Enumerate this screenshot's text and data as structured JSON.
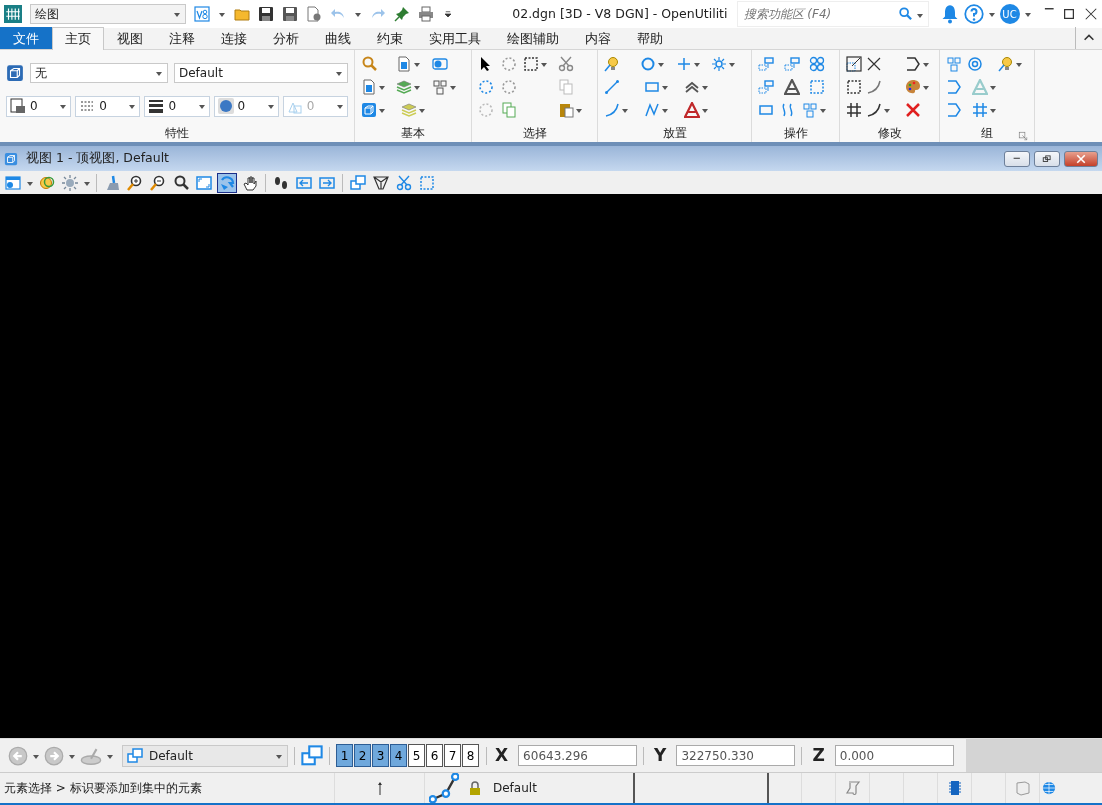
{
  "workflow": {
    "value": "绘图"
  },
  "window": {
    "title": "02.dgn [3D - V8 DGN] - OpenUtiliti"
  },
  "search": {
    "placeholder": "搜索功能区 (F4)"
  },
  "user": {
    "initials": "UC"
  },
  "tabs": [
    {
      "label": "文件",
      "kind": "file",
      "selected": false
    },
    {
      "label": "主页",
      "kind": "tab",
      "selected": true
    },
    {
      "label": "视图",
      "kind": "tab",
      "selected": false
    },
    {
      "label": "注释",
      "kind": "tab",
      "selected": false
    },
    {
      "label": "连接",
      "kind": "tab",
      "selected": false
    },
    {
      "label": "分析",
      "kind": "tab",
      "selected": false
    },
    {
      "label": "曲线",
      "kind": "tab",
      "selected": false
    },
    {
      "label": "约束",
      "kind": "tab",
      "selected": false
    },
    {
      "label": "实用工具",
      "kind": "tab",
      "selected": false
    },
    {
      "label": "绘图辅助",
      "kind": "tab",
      "selected": false
    },
    {
      "label": "内容",
      "kind": "tab",
      "selected": false
    },
    {
      "label": "帮助",
      "kind": "tab",
      "selected": false
    }
  ],
  "attributes": {
    "level": "无",
    "text_style": "Default",
    "fields": [
      {
        "value": "0",
        "disabled": false
      },
      {
        "value": "0",
        "disabled": false
      },
      {
        "value": "0",
        "disabled": false
      },
      {
        "value": "0",
        "disabled": false
      },
      {
        "value": "0",
        "disabled": true
      }
    ]
  },
  "ribbon_groups": [
    {
      "label": "特性"
    },
    {
      "label": "基本"
    },
    {
      "label": "选择"
    },
    {
      "label": "放置"
    },
    {
      "label": "操作"
    },
    {
      "label": "修改"
    },
    {
      "label": "组"
    }
  ],
  "view": {
    "title": "视图 1 - 顶视图, Default"
  },
  "view_toolbar": {
    "tools": [
      {
        "selected": false
      },
      {
        "selected": false
      },
      {
        "selected": false
      },
      {
        "selected": false
      },
      {
        "selected": false
      },
      {
        "selected": false
      },
      {
        "selected": false
      },
      {
        "selected": false
      },
      {
        "selected": true
      },
      {
        "selected": false
      },
      {
        "selected": false
      },
      {
        "selected": false
      },
      {
        "selected": false
      },
      {
        "selected": false
      },
      {
        "selected": false
      },
      {
        "selected": false
      },
      {
        "selected": false
      }
    ]
  },
  "bottom_toolbar": {
    "saved_view": "Default",
    "views": [
      {
        "label": "1",
        "selected": true
      },
      {
        "label": "2",
        "selected": true
      },
      {
        "label": "3",
        "selected": true
      },
      {
        "label": "4",
        "selected": true
      },
      {
        "label": "5",
        "selected": false
      },
      {
        "label": "6",
        "selected": false
      },
      {
        "label": "7",
        "selected": false
      },
      {
        "label": "8",
        "selected": false
      }
    ],
    "coordinates": [
      {
        "axis": "X",
        "value": "60643.296"
      },
      {
        "axis": "Y",
        "value": "322750.330"
      },
      {
        "axis": "Z",
        "value": "0.000"
      }
    ]
  },
  "status_bar": {
    "prompt": "元素选择 > 标识要添加到集中的元素",
    "active_level": "Default"
  }
}
